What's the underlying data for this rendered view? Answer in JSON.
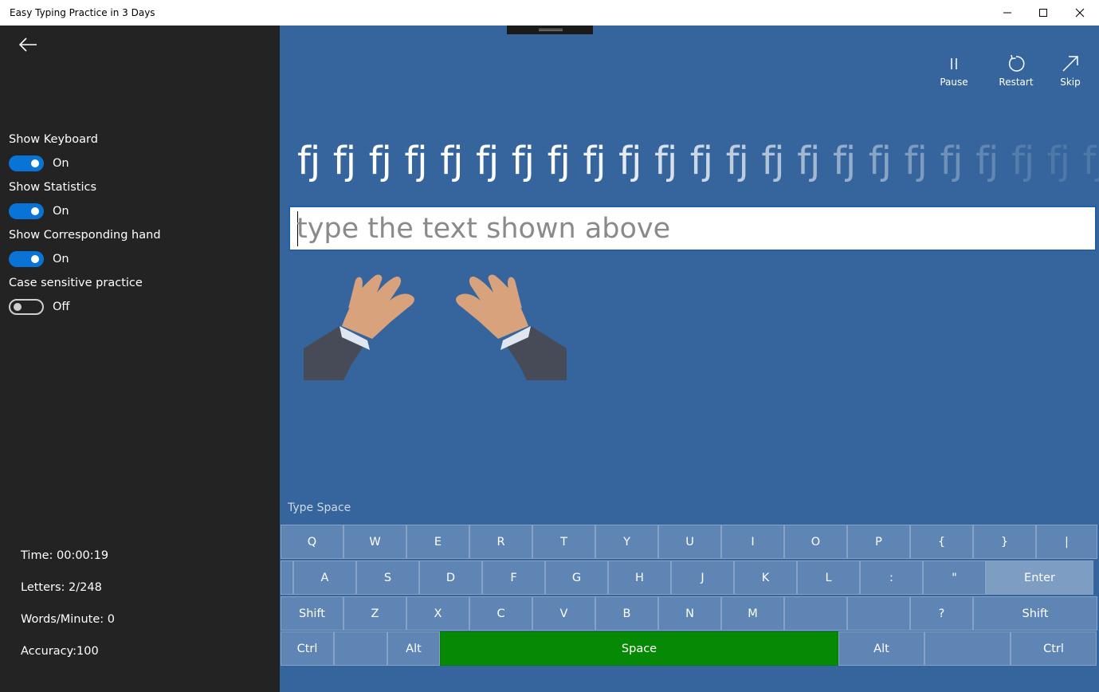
{
  "window": {
    "title": "Easy Typing Practice in 3 Days"
  },
  "sidebar": {
    "settings": [
      {
        "label": "Show Keyboard",
        "state": "On",
        "on": true
      },
      {
        "label": "Show Statistics",
        "state": "On",
        "on": true
      },
      {
        "label": "Show Corresponding hand",
        "state": "On",
        "on": true
      },
      {
        "label": "Case sensitive practice",
        "state": "Off",
        "on": false
      }
    ],
    "stats": {
      "time": "Time: 00:00:19",
      "letters": "Letters: 2/248",
      "wpm": "Words/Minute: 0",
      "accuracy": "Accuracy:100"
    }
  },
  "commands": {
    "pause": "Pause",
    "restart": "Restart",
    "skip": "Skip"
  },
  "practice": {
    "words": [
      "fj",
      "fj",
      "fj",
      "fj",
      "fj",
      "fj",
      "fj",
      "fj",
      "fj",
      "fj",
      "fj",
      "fj",
      "fj",
      "fj",
      "fj",
      "fj",
      "fj",
      "fj",
      "fj",
      "fj",
      "fj",
      "fj",
      "fj"
    ]
  },
  "input": {
    "placeholder": "type the text shown above",
    "value": ""
  },
  "hint": "Type Space",
  "keyboard": {
    "row1": [
      "Q",
      "W",
      "E",
      "R",
      "T",
      "Y",
      "U",
      "I",
      "O",
      "P",
      "{",
      "}",
      "|"
    ],
    "row2": [
      "",
      "A",
      "S",
      "D",
      "F",
      "G",
      "H",
      "J",
      "K",
      "L",
      ":",
      "\"",
      "Enter"
    ],
    "row3": [
      "Shift",
      "Z",
      "X",
      "C",
      "V",
      "B",
      "N",
      "M",
      "",
      "",
      "?",
      "Shift"
    ],
    "row4": [
      "Ctrl",
      "",
      "Alt",
      "Space",
      "Alt",
      "",
      "Ctrl"
    ],
    "highlight_key": "Space"
  },
  "colors": {
    "sidebar_bg": "#232323",
    "main_bg": "#35659c",
    "accent": "#0a74d6",
    "key_bg": "#5e85b4",
    "highlight": "#068a06"
  }
}
